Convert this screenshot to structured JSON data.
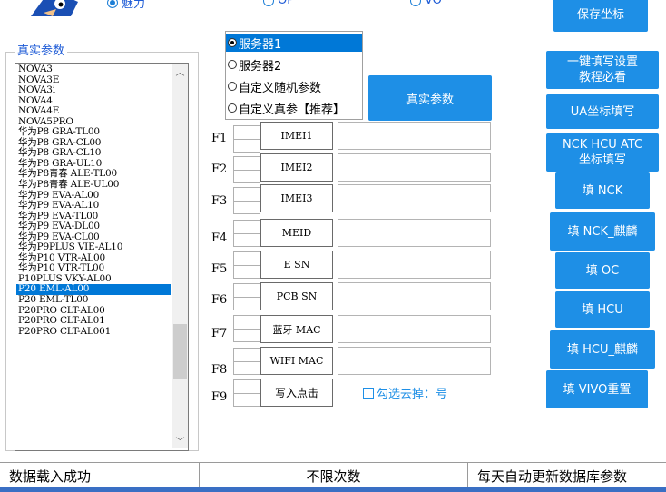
{
  "top_options": [
    {
      "label": "魅力",
      "checked": true
    },
    {
      "label": "OP",
      "checked": false
    },
    {
      "label": "VO",
      "checked": false
    }
  ],
  "right_buttons": [
    {
      "label": "保存坐标"
    },
    {
      "label": "一键填写设置\n教程必看"
    },
    {
      "label": "UA坐标填写"
    },
    {
      "label": "NCK HCU ATC\n坐标填写"
    },
    {
      "label": "填 NCK"
    },
    {
      "label": "填 NCK_麒麟"
    },
    {
      "label": "填 OC"
    },
    {
      "label": "填 HCU"
    },
    {
      "label": "填 HCU_麒麟"
    },
    {
      "label": "填 VIVO重置"
    }
  ],
  "device_panel": {
    "title": "真实参数",
    "devices": [
      "NOVA3",
      "NOVA3E",
      "NOVA3i",
      "NOVA4",
      "NOVA4E",
      "NOVA5PRO",
      "华为P8 GRA-TL00",
      "华为P8 GRA-CL00",
      "华为P8 GRA-CL10",
      "华为P8 GRA-UL10",
      "华为P8青春 ALE-TL00",
      "华为P8青春 ALE-UL00",
      "华为P9 EVA-AL00",
      "华为P9 EVA-AL10",
      "华为P9 EVA-TL00",
      "华为P9 EVA-DL00",
      "华为P9 EVA-CL00",
      "华为P9PLUS VIE-AL10",
      "华为P10 VTR-AL00",
      "华为P10 VTR-TL00",
      "P10PLUS VKY-AL00",
      "P20 EML-AL00",
      "P20 EML-TL00",
      "P20PRO CLT-AL00",
      "P20PRO CLT-AL01",
      "P20PRO CLT-AL001"
    ],
    "selected": "P20 EML-AL00"
  },
  "servers": [
    {
      "label": "服务器1",
      "checked": true,
      "highlight": true
    },
    {
      "label": "服务器2",
      "checked": false,
      "highlight": false
    },
    {
      "label": "自定义随机参数",
      "checked": false,
      "highlight": false
    },
    {
      "label": "自定义真参【推荐】",
      "checked": false,
      "highlight": false
    }
  ],
  "real_params_button": "真实参数",
  "fields": [
    {
      "key": "F1",
      "button": "IMEI1",
      "value": ""
    },
    {
      "key": "F2",
      "button": "IMEI2",
      "value": ""
    },
    {
      "key": "F3",
      "button": "IMEI3",
      "value": ""
    },
    {
      "key": "F4",
      "button": "MEID",
      "value": ""
    },
    {
      "key": "F5",
      "button": "E SN",
      "value": ""
    },
    {
      "key": "F6",
      "button": "PCB SN",
      "value": ""
    },
    {
      "key": "F7",
      "button": "蓝牙 MAC",
      "value": ""
    },
    {
      "key": "F8",
      "button": "WIFI MAC",
      "value": ""
    },
    {
      "key": "F9",
      "button": "写入点击",
      "value": null
    }
  ],
  "remove_colon_option": {
    "label": "勾选去掉：号",
    "checked": false
  },
  "status_bar": {
    "left": "数据载入成功",
    "middle": "不限次数",
    "right": "每天自动更新数据库参数"
  },
  "colors": {
    "accent": "#1e8fe6",
    "selection": "#0078d7",
    "title_blue": "#1e5bd6"
  }
}
